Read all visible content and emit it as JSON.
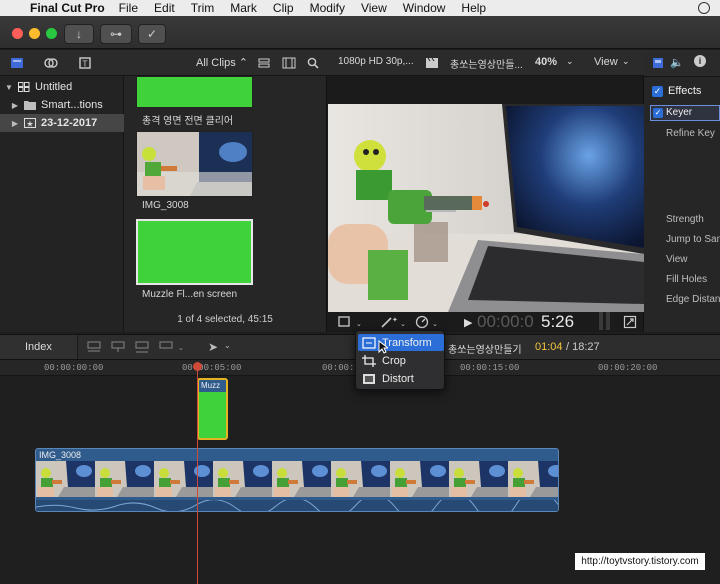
{
  "menubar": {
    "app_name": "Final Cut Pro",
    "items": [
      "File",
      "Edit",
      "Trim",
      "Mark",
      "Clip",
      "Modify",
      "View",
      "Window",
      "Help"
    ]
  },
  "browser_header": {
    "filter": "All Clips ⌃",
    "format": "1080p HD 30p,...",
    "project": "총쏘는영상만들...",
    "zoom": "40%",
    "view": "View"
  },
  "libraries": {
    "items": [
      {
        "label": "Untitled"
      },
      {
        "label": "Smart...tions"
      },
      {
        "label": "23-12-2017"
      }
    ]
  },
  "browser": {
    "clips": [
      {
        "label": "총격 영면 전면 클리어"
      },
      {
        "label": "IMG_3008"
      },
      {
        "label": "Muzzle Fl...en screen"
      }
    ],
    "selection_info": "1 of 4 selected, 45:15"
  },
  "viewer": {
    "timecode_dim": "00:00:0",
    "timecode_bright": "5:26"
  },
  "inspector": {
    "effects_label": "Effects",
    "keyer_label": "Keyer",
    "params": [
      "Refine Key",
      "Strength",
      "Jump to Sam",
      "View",
      "Fill Holes",
      "Edge Distan"
    ]
  },
  "timeline_header": {
    "index_label": "Index",
    "project_name": "총쏘는영상만들기",
    "position": "01:04",
    "duration": "/ 18:27"
  },
  "ruler": {
    "ticks": [
      "00:00:00:00",
      "00:00:05:00",
      "00:00:10:00",
      "00:00:15:00",
      "00:00:20:00"
    ]
  },
  "timeline": {
    "connected_clip": "Muzz",
    "primary_clip": "IMG_3008"
  },
  "popup_menu": {
    "items": [
      {
        "label": "Transform"
      },
      {
        "label": "Crop"
      },
      {
        "label": "Distort"
      }
    ]
  },
  "watermark": "http://toytvstory.tistory.com",
  "colors": {
    "accent": "#2c6ed8",
    "green_screen": "#3fd23a",
    "clip_blue": "#2f5b8d",
    "connected_yellow": "#e6b422",
    "playhead": "#d04a3a"
  }
}
